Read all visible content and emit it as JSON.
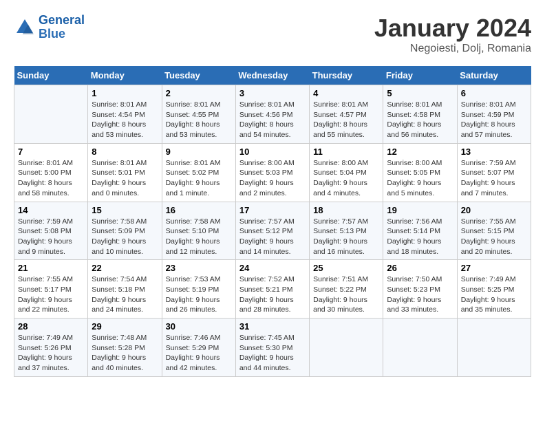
{
  "logo": {
    "line1": "General",
    "line2": "Blue"
  },
  "title": "January 2024",
  "subtitle": "Negoiesti, Dolj, Romania",
  "weekdays": [
    "Sunday",
    "Monday",
    "Tuesday",
    "Wednesday",
    "Thursday",
    "Friday",
    "Saturday"
  ],
  "weeks": [
    [
      {
        "day": "",
        "sunrise": "",
        "sunset": "",
        "daylight": ""
      },
      {
        "day": "1",
        "sunrise": "Sunrise: 8:01 AM",
        "sunset": "Sunset: 4:54 PM",
        "daylight": "Daylight: 8 hours and 53 minutes."
      },
      {
        "day": "2",
        "sunrise": "Sunrise: 8:01 AM",
        "sunset": "Sunset: 4:55 PM",
        "daylight": "Daylight: 8 hours and 53 minutes."
      },
      {
        "day": "3",
        "sunrise": "Sunrise: 8:01 AM",
        "sunset": "Sunset: 4:56 PM",
        "daylight": "Daylight: 8 hours and 54 minutes."
      },
      {
        "day": "4",
        "sunrise": "Sunrise: 8:01 AM",
        "sunset": "Sunset: 4:57 PM",
        "daylight": "Daylight: 8 hours and 55 minutes."
      },
      {
        "day": "5",
        "sunrise": "Sunrise: 8:01 AM",
        "sunset": "Sunset: 4:58 PM",
        "daylight": "Daylight: 8 hours and 56 minutes."
      },
      {
        "day": "6",
        "sunrise": "Sunrise: 8:01 AM",
        "sunset": "Sunset: 4:59 PM",
        "daylight": "Daylight: 8 hours and 57 minutes."
      }
    ],
    [
      {
        "day": "7",
        "sunrise": "Sunrise: 8:01 AM",
        "sunset": "Sunset: 5:00 PM",
        "daylight": "Daylight: 8 hours and 58 minutes."
      },
      {
        "day": "8",
        "sunrise": "Sunrise: 8:01 AM",
        "sunset": "Sunset: 5:01 PM",
        "daylight": "Daylight: 9 hours and 0 minutes."
      },
      {
        "day": "9",
        "sunrise": "Sunrise: 8:01 AM",
        "sunset": "Sunset: 5:02 PM",
        "daylight": "Daylight: 9 hours and 1 minute."
      },
      {
        "day": "10",
        "sunrise": "Sunrise: 8:00 AM",
        "sunset": "Sunset: 5:03 PM",
        "daylight": "Daylight: 9 hours and 2 minutes."
      },
      {
        "day": "11",
        "sunrise": "Sunrise: 8:00 AM",
        "sunset": "Sunset: 5:04 PM",
        "daylight": "Daylight: 9 hours and 4 minutes."
      },
      {
        "day": "12",
        "sunrise": "Sunrise: 8:00 AM",
        "sunset": "Sunset: 5:05 PM",
        "daylight": "Daylight: 9 hours and 5 minutes."
      },
      {
        "day": "13",
        "sunrise": "Sunrise: 7:59 AM",
        "sunset": "Sunset: 5:07 PM",
        "daylight": "Daylight: 9 hours and 7 minutes."
      }
    ],
    [
      {
        "day": "14",
        "sunrise": "Sunrise: 7:59 AM",
        "sunset": "Sunset: 5:08 PM",
        "daylight": "Daylight: 9 hours and 9 minutes."
      },
      {
        "day": "15",
        "sunrise": "Sunrise: 7:58 AM",
        "sunset": "Sunset: 5:09 PM",
        "daylight": "Daylight: 9 hours and 10 minutes."
      },
      {
        "day": "16",
        "sunrise": "Sunrise: 7:58 AM",
        "sunset": "Sunset: 5:10 PM",
        "daylight": "Daylight: 9 hours and 12 minutes."
      },
      {
        "day": "17",
        "sunrise": "Sunrise: 7:57 AM",
        "sunset": "Sunset: 5:12 PM",
        "daylight": "Daylight: 9 hours and 14 minutes."
      },
      {
        "day": "18",
        "sunrise": "Sunrise: 7:57 AM",
        "sunset": "Sunset: 5:13 PM",
        "daylight": "Daylight: 9 hours and 16 minutes."
      },
      {
        "day": "19",
        "sunrise": "Sunrise: 7:56 AM",
        "sunset": "Sunset: 5:14 PM",
        "daylight": "Daylight: 9 hours and 18 minutes."
      },
      {
        "day": "20",
        "sunrise": "Sunrise: 7:55 AM",
        "sunset": "Sunset: 5:15 PM",
        "daylight": "Daylight: 9 hours and 20 minutes."
      }
    ],
    [
      {
        "day": "21",
        "sunrise": "Sunrise: 7:55 AM",
        "sunset": "Sunset: 5:17 PM",
        "daylight": "Daylight: 9 hours and 22 minutes."
      },
      {
        "day": "22",
        "sunrise": "Sunrise: 7:54 AM",
        "sunset": "Sunset: 5:18 PM",
        "daylight": "Daylight: 9 hours and 24 minutes."
      },
      {
        "day": "23",
        "sunrise": "Sunrise: 7:53 AM",
        "sunset": "Sunset: 5:19 PM",
        "daylight": "Daylight: 9 hours and 26 minutes."
      },
      {
        "day": "24",
        "sunrise": "Sunrise: 7:52 AM",
        "sunset": "Sunset: 5:21 PM",
        "daylight": "Daylight: 9 hours and 28 minutes."
      },
      {
        "day": "25",
        "sunrise": "Sunrise: 7:51 AM",
        "sunset": "Sunset: 5:22 PM",
        "daylight": "Daylight: 9 hours and 30 minutes."
      },
      {
        "day": "26",
        "sunrise": "Sunrise: 7:50 AM",
        "sunset": "Sunset: 5:23 PM",
        "daylight": "Daylight: 9 hours and 33 minutes."
      },
      {
        "day": "27",
        "sunrise": "Sunrise: 7:49 AM",
        "sunset": "Sunset: 5:25 PM",
        "daylight": "Daylight: 9 hours and 35 minutes."
      }
    ],
    [
      {
        "day": "28",
        "sunrise": "Sunrise: 7:49 AM",
        "sunset": "Sunset: 5:26 PM",
        "daylight": "Daylight: 9 hours and 37 minutes."
      },
      {
        "day": "29",
        "sunrise": "Sunrise: 7:48 AM",
        "sunset": "Sunset: 5:28 PM",
        "daylight": "Daylight: 9 hours and 40 minutes."
      },
      {
        "day": "30",
        "sunrise": "Sunrise: 7:46 AM",
        "sunset": "Sunset: 5:29 PM",
        "daylight": "Daylight: 9 hours and 42 minutes."
      },
      {
        "day": "31",
        "sunrise": "Sunrise: 7:45 AM",
        "sunset": "Sunset: 5:30 PM",
        "daylight": "Daylight: 9 hours and 44 minutes."
      },
      {
        "day": "",
        "sunrise": "",
        "sunset": "",
        "daylight": ""
      },
      {
        "day": "",
        "sunrise": "",
        "sunset": "",
        "daylight": ""
      },
      {
        "day": "",
        "sunrise": "",
        "sunset": "",
        "daylight": ""
      }
    ]
  ]
}
